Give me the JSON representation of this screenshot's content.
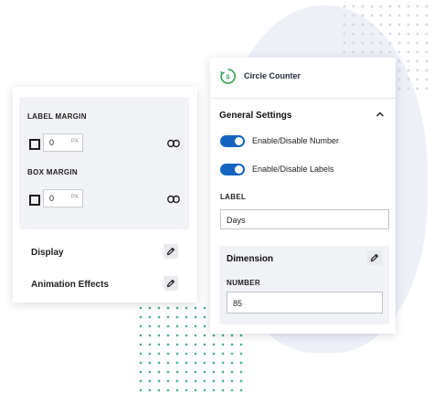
{
  "left_panel": {
    "label_margin": {
      "title": "LABEL MARGIN",
      "value": "0",
      "unit": "PX"
    },
    "box_margin": {
      "title": "BOX MARGIN",
      "value": "0",
      "unit": "PX"
    },
    "rows": [
      {
        "label": "Display"
      },
      {
        "label": "Animation Effects"
      }
    ]
  },
  "right_panel": {
    "title": "Circle Counter",
    "icon_text": "0",
    "general_settings": {
      "title": "General Settings",
      "toggles": [
        {
          "label": "Enable/Disable Number",
          "on": true
        },
        {
          "label": "Enable/Disable Labels",
          "on": true
        }
      ],
      "label_field": {
        "label": "LABEL",
        "value": "Days"
      }
    },
    "dimension": {
      "title": "Dimension",
      "number_label": "NUMBER",
      "number_value": "85"
    }
  },
  "colors": {
    "toggle_on": "#1565c0",
    "icon_green": "#2e9e57",
    "dot_green": "#4caf7a"
  }
}
